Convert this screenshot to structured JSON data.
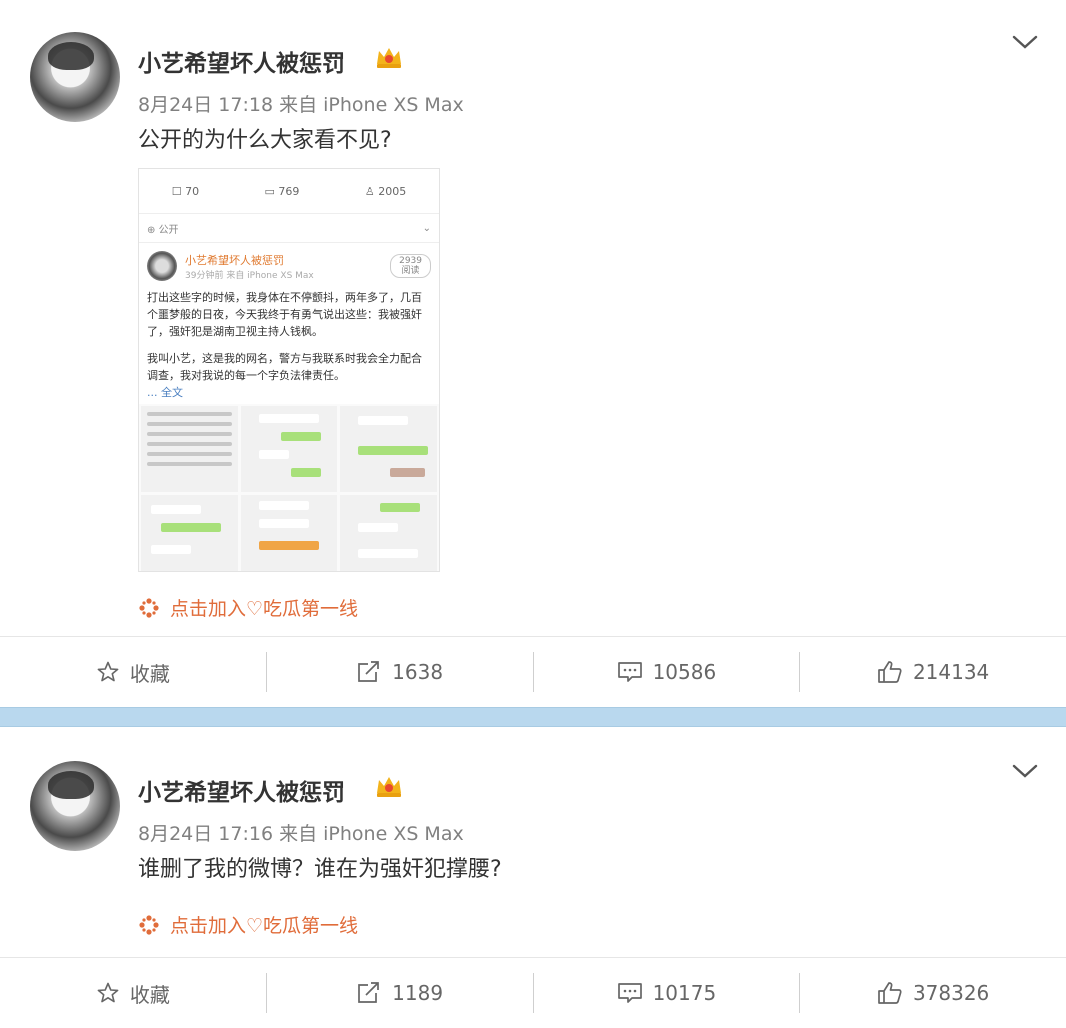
{
  "posts": [
    {
      "author": "小艺希望坏人被惩罚",
      "meta": "8月24日 17:18 来自 iPhone XS Max",
      "text": "公开的为什么大家看不见?",
      "join_link": "点击加入♡吃瓜第一线",
      "actions": {
        "favorite": "收藏",
        "repost": "1638",
        "comment": "10586",
        "like": "214134"
      },
      "embedded": {
        "counts": {
          "repost": "70",
          "comment": "769",
          "like": "2005"
        },
        "visibility": "公开",
        "author": "小艺希望坏人被惩罚",
        "meta": "39分钟前  来自 iPhone XS Max",
        "reads": "2939",
        "reads_label": "阅读",
        "para1": "打出这些字的时候，我身体在不停颤抖，两年多了，几百个噩梦般的日夜，今天我终于有勇气说出这些：我被强奸了，强奸犯是湖南卫视主持人钱枫。",
        "para2": "我叫小艺，这是我的网名，警方与我联系时我会全力配合调查，我对我说的每一个字负法律责任。",
        "more": "... 全文"
      }
    },
    {
      "author": "小艺希望坏人被惩罚",
      "meta": "8月24日 17:16 来自 iPhone XS Max",
      "text": "谁删了我的微博？谁在为强奸犯撑腰?",
      "join_link": "点击加入♡吃瓜第一线",
      "actions": {
        "favorite": "收藏",
        "repost": "1189",
        "comment": "10175",
        "like": "378326"
      }
    }
  ],
  "colors": {
    "accent": "#e06c3a",
    "divider": "#b9d8ee",
    "crown": "#f3b31b"
  }
}
